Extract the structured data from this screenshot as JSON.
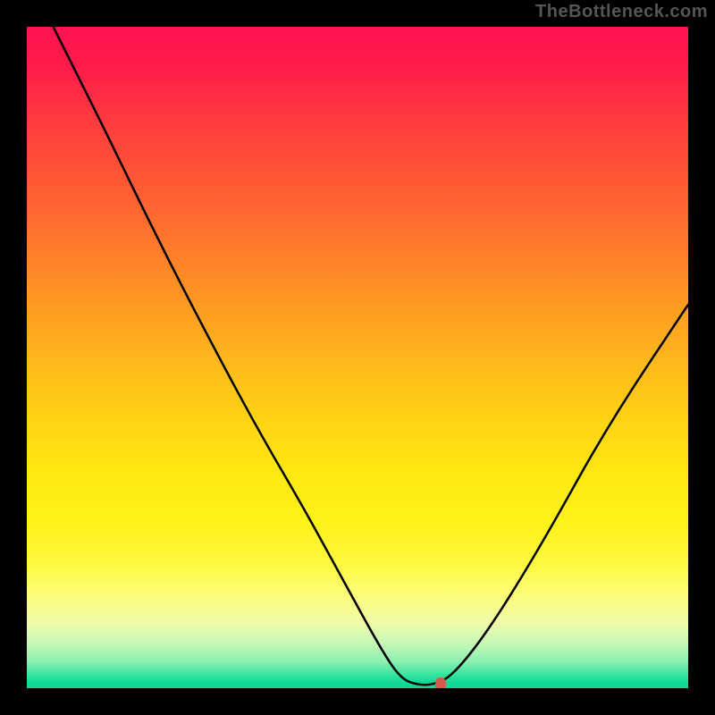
{
  "watermark": "TheBottleneck.com",
  "chart_data": {
    "type": "line",
    "title": "",
    "xlabel": "",
    "ylabel": "",
    "xlim": [
      0,
      100
    ],
    "ylim": [
      0,
      100
    ],
    "grid": false,
    "legend": false,
    "series": [
      {
        "name": "curve",
        "x": [
          4,
          12,
          20,
          28,
          35,
          42,
          48,
          53.5,
          56.5,
          59,
          61.5,
          64.5,
          70,
          78,
          88,
          100
        ],
        "y": [
          100,
          84,
          67.5,
          52,
          39,
          27,
          16,
          6,
          1.5,
          0.5,
          0.5,
          2,
          9,
          22,
          40,
          58
        ]
      }
    ],
    "marker": {
      "x": 62.5,
      "y": 0.5,
      "color": "#d9584e"
    },
    "gradient_stops": [
      {
        "pos": 0,
        "color": "#ff1450"
      },
      {
        "pos": 0.33,
        "color": "#ff7a2b"
      },
      {
        "pos": 0.6,
        "color": "#ffd514"
      },
      {
        "pos": 0.81,
        "color": "#fff83e"
      },
      {
        "pos": 0.93,
        "color": "#c9f8b6"
      },
      {
        "pos": 1.0,
        "color": "#0dd895"
      }
    ]
  }
}
